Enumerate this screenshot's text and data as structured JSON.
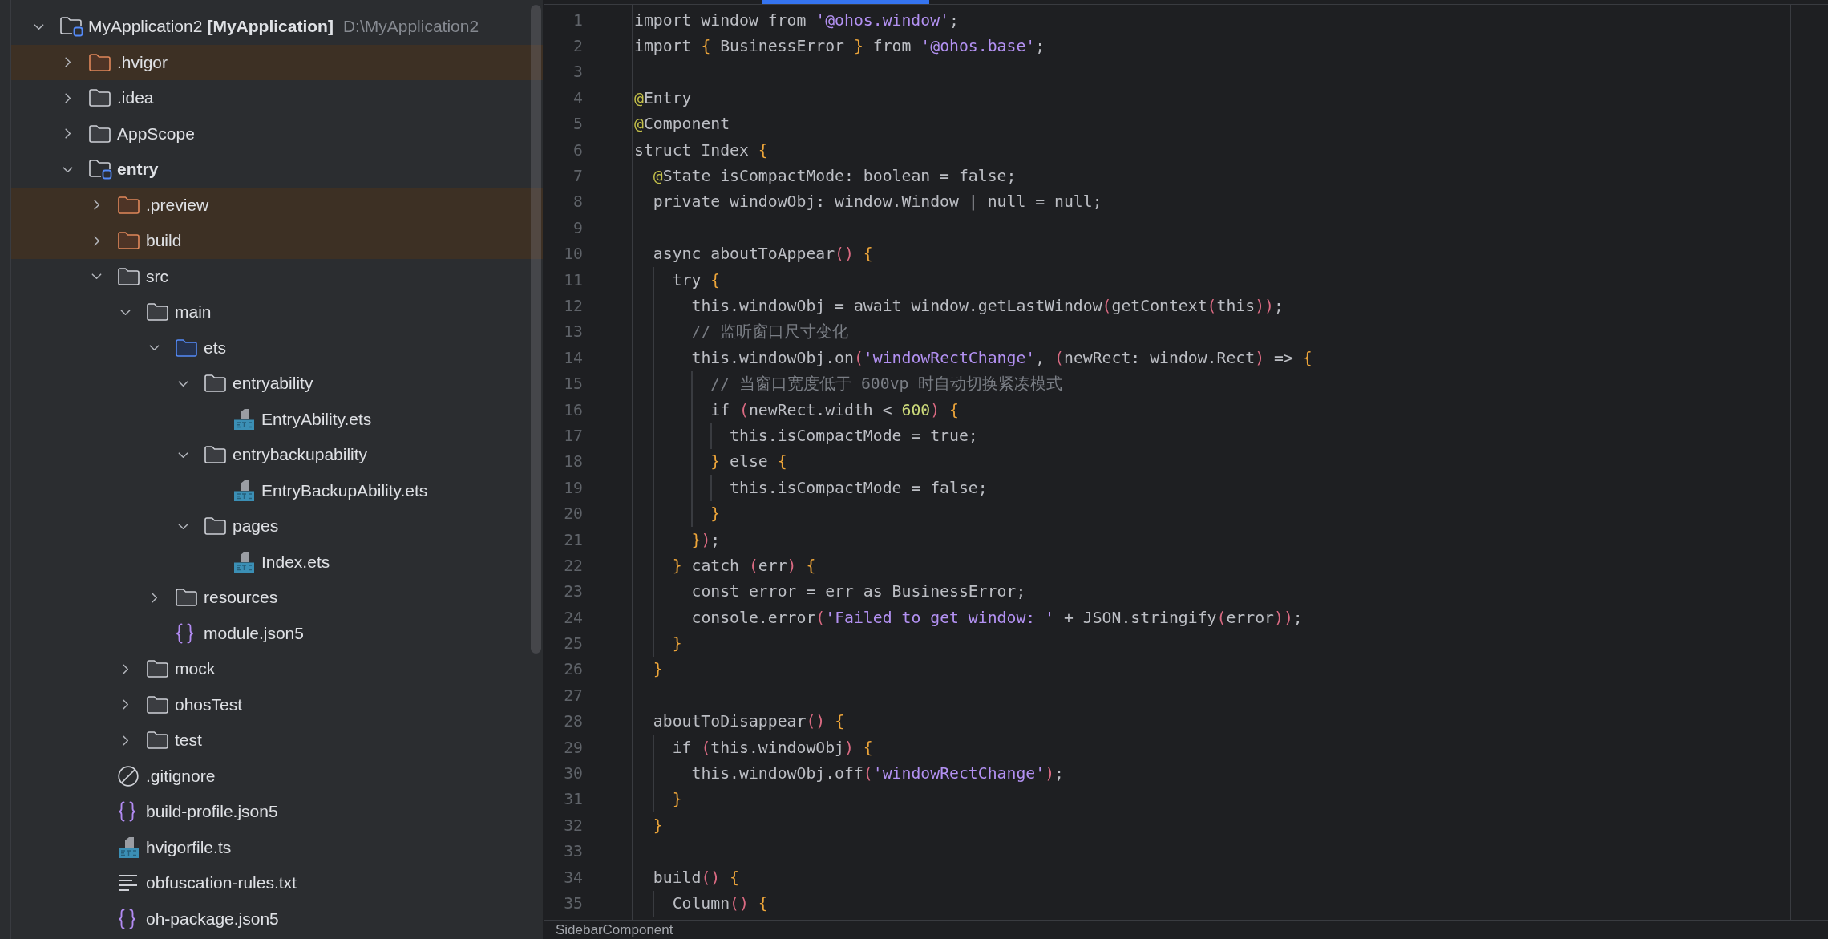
{
  "project_tree": {
    "items": [
      {
        "kind": "project",
        "label": "MyApplication2",
        "module": "[MyApplication]",
        "path": "D:\\MyApplication2",
        "expanded": true,
        "children": [
          {
            "kind": "excluded-folder",
            "label": ".hvigor",
            "expanded": false
          },
          {
            "kind": "folder",
            "label": ".idea",
            "expanded": false
          },
          {
            "kind": "folder",
            "label": "AppScope",
            "expanded": false
          },
          {
            "kind": "module",
            "label": "entry",
            "expanded": true,
            "children": [
              {
                "kind": "excluded-folder",
                "label": ".preview",
                "expanded": false
              },
              {
                "kind": "excluded-folder",
                "label": "build",
                "expanded": false
              },
              {
                "kind": "folder",
                "label": "src",
                "expanded": true,
                "children": [
                  {
                    "kind": "folder",
                    "label": "main",
                    "expanded": true,
                    "children": [
                      {
                        "kind": "source-folder",
                        "label": "ets",
                        "expanded": true,
                        "children": [
                          {
                            "kind": "folder",
                            "label": "entryability",
                            "expanded": true,
                            "children": [
                              {
                                "kind": "ets-file",
                                "label": "EntryAbility.ets"
                              }
                            ]
                          },
                          {
                            "kind": "folder",
                            "label": "entrybackupability",
                            "expanded": true,
                            "children": [
                              {
                                "kind": "ets-file",
                                "label": "EntryBackupAbility.ets"
                              }
                            ]
                          },
                          {
                            "kind": "folder",
                            "label": "pages",
                            "expanded": true,
                            "children": [
                              {
                                "kind": "ets-file",
                                "label": "Index.ets"
                              }
                            ]
                          }
                        ]
                      },
                      {
                        "kind": "folder",
                        "label": "resources",
                        "expanded": false
                      },
                      {
                        "kind": "json-file",
                        "label": "module.json5"
                      }
                    ]
                  },
                  {
                    "kind": "folder",
                    "label": "mock",
                    "expanded": false
                  },
                  {
                    "kind": "folder",
                    "label": "ohosTest",
                    "expanded": false
                  },
                  {
                    "kind": "folder",
                    "label": "test",
                    "expanded": false
                  }
                ]
              },
              {
                "kind": "ignore-file",
                "label": ".gitignore"
              },
              {
                "kind": "json-file",
                "label": "build-profile.json5"
              },
              {
                "kind": "ts-file",
                "label": "hvigorfile.ts"
              },
              {
                "kind": "text-file",
                "label": "obfuscation-rules.txt"
              },
              {
                "kind": "json-file",
                "label": "oh-package.json5"
              }
            ]
          }
        ]
      }
    ]
  },
  "editor": {
    "lines": [
      {
        "number": "1",
        "tokens": [
          {
            "kind": "plain",
            "text": "import window from "
          },
          {
            "kind": "string",
            "text": "'@ohos.window'"
          },
          {
            "kind": "plain",
            "text": ";"
          }
        ]
      },
      {
        "number": "2",
        "tokens": [
          {
            "kind": "plain",
            "text": "import "
          },
          {
            "kind": "brace",
            "text": "{"
          },
          {
            "kind": "plain",
            "text": " BusinessError "
          },
          {
            "kind": "brace",
            "text": "}"
          },
          {
            "kind": "plain",
            "text": " from "
          },
          {
            "kind": "string",
            "text": "'@ohos.base'"
          },
          {
            "kind": "plain",
            "text": ";"
          }
        ]
      },
      {
        "number": "3"
      },
      {
        "number": "4",
        "tokens": [
          {
            "kind": "at",
            "text": "@"
          },
          {
            "kind": "plain",
            "text": "Entry"
          }
        ]
      },
      {
        "number": "5",
        "tokens": [
          {
            "kind": "at",
            "text": "@"
          },
          {
            "kind": "plain",
            "text": "Component"
          }
        ]
      },
      {
        "number": "6",
        "tokens": [
          {
            "kind": "plain",
            "text": "struct Index "
          },
          {
            "kind": "brace",
            "text": "{"
          }
        ]
      },
      {
        "number": "7",
        "tokens": [
          {
            "kind": "at",
            "text": "  @"
          },
          {
            "kind": "plain",
            "text": "State isCompactMode: boolean = false;"
          }
        ]
      },
      {
        "number": "8",
        "tokens": [
          {
            "kind": "plain",
            "text": "  private windowObj: window.Window | null = null;"
          }
        ]
      },
      {
        "number": "9"
      },
      {
        "number": "10",
        "tokens": [
          {
            "kind": "plain",
            "text": "  async aboutToAppear"
          },
          {
            "kind": "paren",
            "text": "()"
          },
          {
            "kind": "brace",
            "text": " {"
          }
        ]
      },
      {
        "number": "11",
        "tokens": [
          {
            "kind": "plain",
            "text": "    try "
          },
          {
            "kind": "brace",
            "text": "{"
          }
        ]
      },
      {
        "number": "12",
        "tokens": [
          {
            "kind": "plain",
            "text": "      this.windowObj = await window.getLastWindow"
          },
          {
            "kind": "paren",
            "text": "("
          },
          {
            "kind": "plain",
            "text": "getContext"
          },
          {
            "kind": "paren",
            "text": "("
          },
          {
            "kind": "plain",
            "text": "this"
          },
          {
            "kind": "paren",
            "text": "))"
          },
          {
            "kind": "plain",
            "text": ";"
          }
        ]
      },
      {
        "number": "13",
        "tokens": [
          {
            "kind": "comment",
            "text": "      // 监听窗口尺寸变化"
          }
        ]
      },
      {
        "number": "14",
        "tokens": [
          {
            "kind": "plain",
            "text": "      this.windowObj.on"
          },
          {
            "kind": "paren",
            "text": "("
          },
          {
            "kind": "string",
            "text": "'windowRectChange'"
          },
          {
            "kind": "plain",
            "text": ", "
          },
          {
            "kind": "paren",
            "text": "("
          },
          {
            "kind": "plain",
            "text": "newRect: window.Rect"
          },
          {
            "kind": "paren",
            "text": ")"
          },
          {
            "kind": "plain",
            "text": " => "
          },
          {
            "kind": "brace",
            "text": "{"
          }
        ]
      },
      {
        "number": "15",
        "tokens": [
          {
            "kind": "comment",
            "text": "        // 当窗口宽度低于 600vp 时自动切换紧凑模式"
          }
        ]
      },
      {
        "number": "16",
        "tokens": [
          {
            "kind": "plain",
            "text": "        if "
          },
          {
            "kind": "paren",
            "text": "("
          },
          {
            "kind": "plain",
            "text": "newRect.width < "
          },
          {
            "kind": "number",
            "text": "600"
          },
          {
            "kind": "paren",
            "text": ")"
          },
          {
            "kind": "brace",
            "text": " {"
          }
        ]
      },
      {
        "number": "17",
        "tokens": [
          {
            "kind": "plain",
            "text": "          this.isCompactMode = true;"
          }
        ]
      },
      {
        "number": "18",
        "tokens": [
          {
            "kind": "brace",
            "text": "        }"
          },
          {
            "kind": "plain",
            "text": " else "
          },
          {
            "kind": "brace",
            "text": "{"
          }
        ]
      },
      {
        "number": "19",
        "tokens": [
          {
            "kind": "plain",
            "text": "          this.isCompactMode = false;"
          }
        ]
      },
      {
        "number": "20",
        "tokens": [
          {
            "kind": "brace",
            "text": "        }"
          }
        ]
      },
      {
        "number": "21",
        "tokens": [
          {
            "kind": "brace",
            "text": "      }"
          },
          {
            "kind": "paren",
            "text": ")"
          },
          {
            "kind": "plain",
            "text": ";"
          }
        ]
      },
      {
        "number": "22",
        "tokens": [
          {
            "kind": "brace",
            "text": "    }"
          },
          {
            "kind": "plain",
            "text": " catch "
          },
          {
            "kind": "paren",
            "text": "("
          },
          {
            "kind": "plain",
            "text": "err"
          },
          {
            "kind": "paren",
            "text": ")"
          },
          {
            "kind": "brace",
            "text": " {"
          }
        ]
      },
      {
        "number": "23",
        "tokens": [
          {
            "kind": "plain",
            "text": "      const error = err as BusinessError;"
          }
        ]
      },
      {
        "number": "24",
        "tokens": [
          {
            "kind": "plain",
            "text": "      console.error"
          },
          {
            "kind": "paren",
            "text": "("
          },
          {
            "kind": "string",
            "text": "'Failed to get window: '"
          },
          {
            "kind": "plain",
            "text": " + JSON.stringify"
          },
          {
            "kind": "paren",
            "text": "("
          },
          {
            "kind": "plain",
            "text": "error"
          },
          {
            "kind": "paren",
            "text": "))"
          },
          {
            "kind": "plain",
            "text": ";"
          }
        ]
      },
      {
        "number": "25",
        "tokens": [
          {
            "kind": "brace",
            "text": "    }"
          }
        ]
      },
      {
        "number": "26",
        "tokens": [
          {
            "kind": "brace",
            "text": "  }"
          }
        ]
      },
      {
        "number": "27"
      },
      {
        "number": "28",
        "tokens": [
          {
            "kind": "plain",
            "text": "  aboutToDisappear"
          },
          {
            "kind": "paren",
            "text": "()"
          },
          {
            "kind": "brace",
            "text": " {"
          }
        ]
      },
      {
        "number": "29",
        "tokens": [
          {
            "kind": "plain",
            "text": "    if "
          },
          {
            "kind": "paren",
            "text": "("
          },
          {
            "kind": "plain",
            "text": "this.windowObj"
          },
          {
            "kind": "paren",
            "text": ")"
          },
          {
            "kind": "brace",
            "text": " {"
          }
        ]
      },
      {
        "number": "30",
        "tokens": [
          {
            "kind": "plain",
            "text": "      this.windowObj.off"
          },
          {
            "kind": "paren",
            "text": "("
          },
          {
            "kind": "string",
            "text": "'windowRectChange'"
          },
          {
            "kind": "paren",
            "text": ")"
          },
          {
            "kind": "plain",
            "text": ";"
          }
        ]
      },
      {
        "number": "31",
        "tokens": [
          {
            "kind": "brace",
            "text": "    }"
          }
        ]
      },
      {
        "number": "32",
        "tokens": [
          {
            "kind": "brace",
            "text": "  }"
          }
        ]
      },
      {
        "number": "33"
      },
      {
        "number": "34",
        "tokens": [
          {
            "kind": "plain",
            "text": "  build"
          },
          {
            "kind": "paren",
            "text": "()"
          },
          {
            "kind": "brace",
            "text": " {"
          }
        ]
      },
      {
        "number": "35",
        "tokens": [
          {
            "kind": "plain",
            "text": "    Column"
          },
          {
            "kind": "paren",
            "text": "()"
          },
          {
            "kind": "brace",
            "text": " {"
          }
        ]
      }
    ],
    "breadcrumb": "SidebarComponent"
  }
}
